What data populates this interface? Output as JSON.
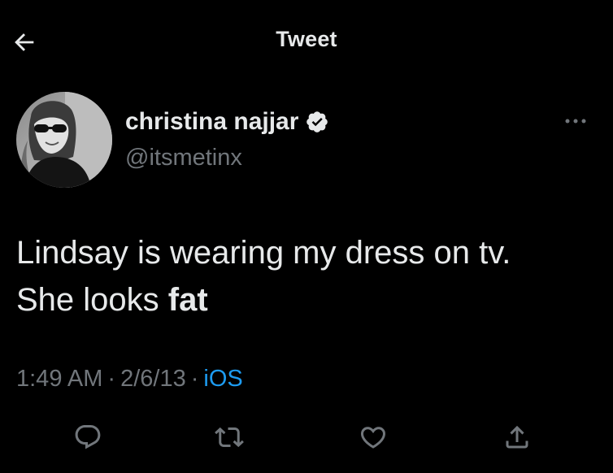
{
  "header": {
    "title": "Tweet",
    "back_icon": "arrow-left-icon"
  },
  "author": {
    "display_name": "christina najjar",
    "handle": "@itsmetinx",
    "verified": true,
    "more_icon": "more-horizontal-icon"
  },
  "tweet": {
    "text_part1": "Lindsay is wearing my dress on tv.",
    "text_part2": "She looks ",
    "text_bold": "fat"
  },
  "meta": {
    "time": "1:49 AM",
    "date": "2/6/13",
    "source": "iOS",
    "separator": "·"
  },
  "actions": {
    "reply_icon": "reply-icon",
    "retweet_icon": "retweet-icon",
    "like_icon": "heart-icon",
    "share_icon": "share-icon"
  },
  "colors": {
    "background": "#000000",
    "text": "#e7e9ea",
    "secondary": "#71767b",
    "accent": "#1d9bf0"
  }
}
